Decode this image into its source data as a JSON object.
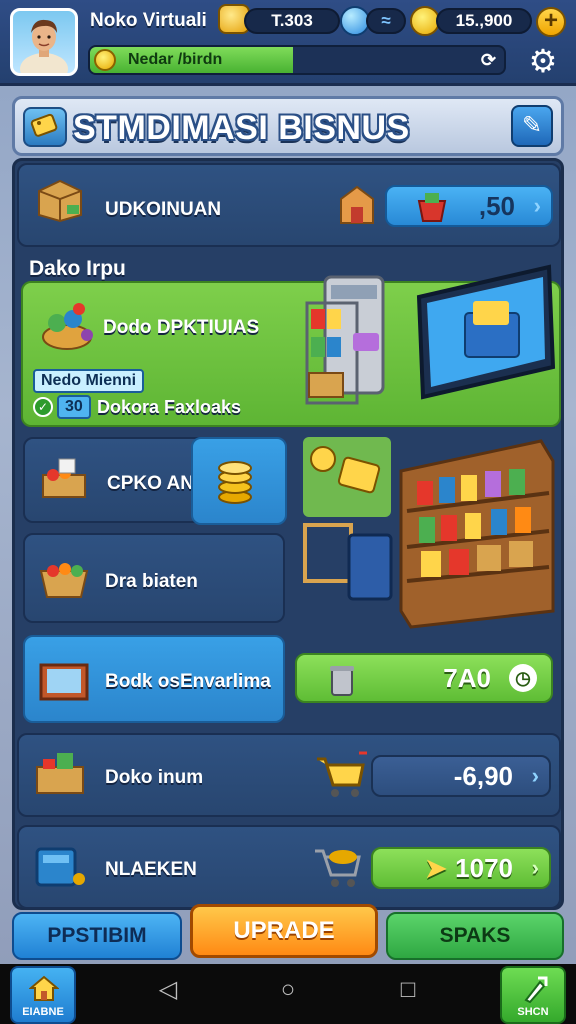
{
  "header": {
    "player_name": "Noko Virtuali",
    "resource_1": "T.303",
    "resource_2": "≈",
    "resource_3": "15.,900",
    "plus_label": "+",
    "progress_label": "Nedar /birdn",
    "progress_fraction": 0.49
  },
  "banner": {
    "title": "STMDIMASI BISNUS"
  },
  "rows": {
    "r1": {
      "label": "UDKOINUAN",
      "price": ",50"
    },
    "section_title": "Dako Irpu",
    "feature": {
      "label": "Dodo DPKTIUIAS",
      "tag_title": "Nedo Mienni",
      "tag_value": "30",
      "tag_desc": "Dokora Faxloaks"
    },
    "r2": {
      "label": "CPKO AN"
    },
    "r3": {
      "label": "Dra biaten"
    },
    "r4": {
      "label": "Bodk osEnvarlima",
      "price": "7A0"
    },
    "r5": {
      "label": "Doko inum",
      "price": "-6,90"
    },
    "r6": {
      "label": "NLAEKEN",
      "price": "1070"
    }
  },
  "buttons": {
    "left": "PPSTIBIM",
    "center": "UPRADE",
    "right": "SPAKS"
  },
  "nav": {
    "home": "EIABNE",
    "shop": "SHCN"
  },
  "colors": {
    "panel": "#263f66",
    "accent_blue": "#2b85cc",
    "accent_green": "#5eb534",
    "accent_orange": "#ff8a14"
  }
}
